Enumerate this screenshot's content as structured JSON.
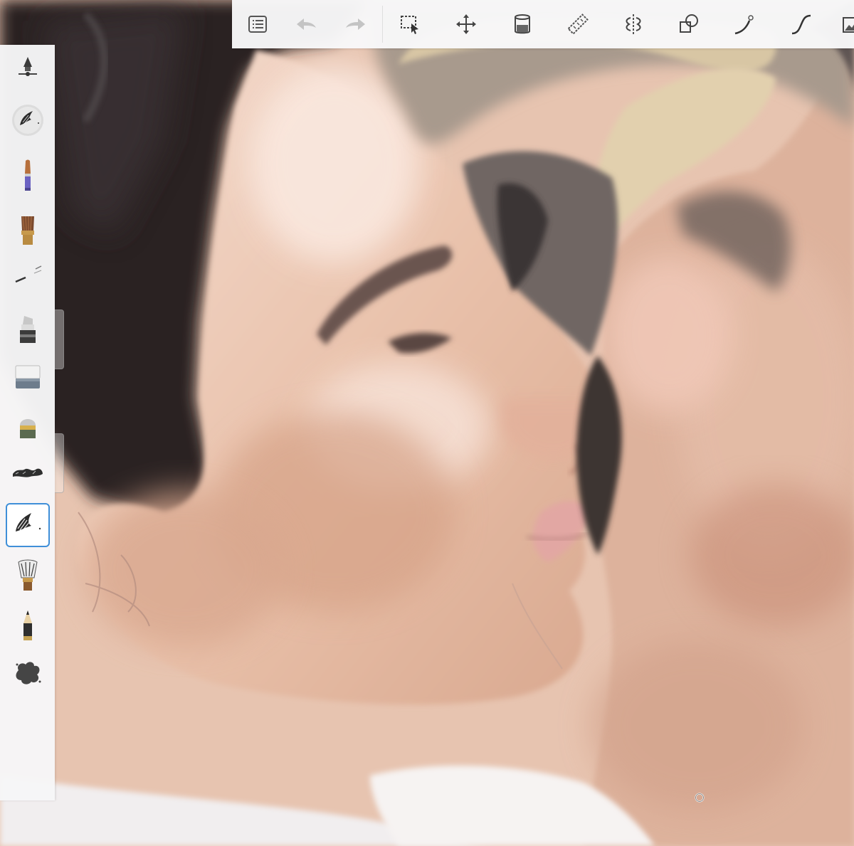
{
  "app": {
    "accent_color": "#3f8fd8",
    "toolbar_background": "#f8f8f9",
    "palette_background": "#f6f6f7"
  },
  "toolbar": {
    "items": [
      {
        "id": "menu",
        "icon": "list-menu-icon"
      },
      {
        "id": "undo",
        "icon": "undo-arrow-icon"
      },
      {
        "id": "redo",
        "icon": "redo-arrow-icon"
      },
      {
        "id": "selection",
        "icon": "selection-icon"
      },
      {
        "id": "transform",
        "icon": "move-icon"
      },
      {
        "id": "fill",
        "icon": "fill-bucket-icon"
      },
      {
        "id": "ruler",
        "icon": "ruler-icon"
      },
      {
        "id": "symmetry",
        "icon": "symmetry-icon"
      },
      {
        "id": "shapes",
        "icon": "shapes-icon"
      },
      {
        "id": "steady-stroke",
        "icon": "steady-stroke-icon"
      },
      {
        "id": "predictive-stroke",
        "icon": "curve-icon"
      },
      {
        "id": "layers",
        "icon": "layers-icon"
      }
    ]
  },
  "brush_palette": {
    "items": [
      {
        "id": "size-opacity",
        "icon": "brush-size-slider-icon"
      },
      {
        "id": "current-brush-preview",
        "icon": "brush-preview-icon"
      },
      {
        "id": "paintbrush",
        "icon": "paintbrush-icon"
      },
      {
        "id": "flat-brush",
        "icon": "flat-brush-icon"
      },
      {
        "id": "airbrush",
        "icon": "airbrush-icon"
      },
      {
        "id": "marker",
        "icon": "marker-icon"
      },
      {
        "id": "eraser",
        "icon": "eraser-icon"
      },
      {
        "id": "soft-eraser",
        "icon": "soft-eraser-icon"
      },
      {
        "id": "texture-brush",
        "icon": "texture-brush-icon"
      },
      {
        "id": "smear-brush",
        "icon": "smear-brush-icon",
        "selected": true
      },
      {
        "id": "fan-brush",
        "icon": "fan-brush-icon"
      },
      {
        "id": "pencil",
        "icon": "pencil-icon"
      },
      {
        "id": "splatter-brush",
        "icon": "splatter-brush-icon"
      }
    ]
  },
  "canvas": {
    "skin_color": "#e8c1ac",
    "hair_dark_color": "#2a2323",
    "hair_light_color": "#d8c6a4",
    "background_color": "#f2f0f1"
  }
}
